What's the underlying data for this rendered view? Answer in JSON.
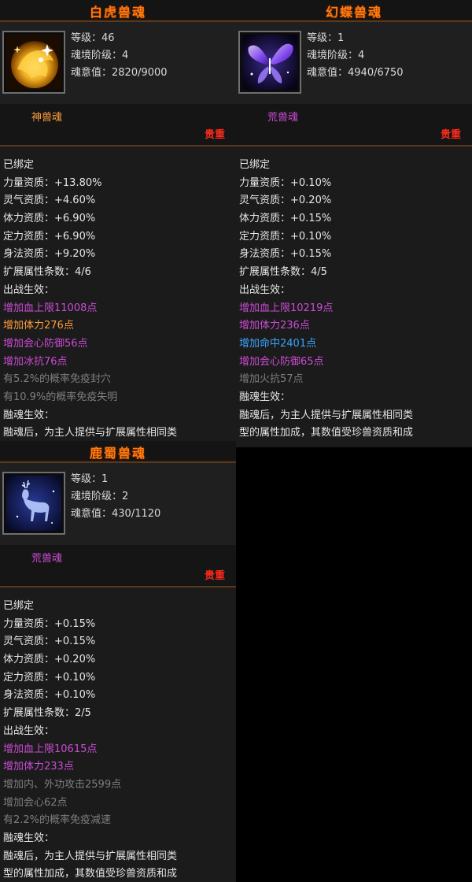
{
  "colors": {
    "title": "#ff7b10",
    "rarity": "#ff2a1a",
    "purple": "#cc4bd6",
    "orange": "#ff9d3a",
    "gray": "#7e7e7e",
    "blue": "#3aa6ff"
  },
  "cards": [
    {
      "title": "白虎兽魂",
      "icon": "golden-tiger-icon",
      "level": "等级：46",
      "realm": "魂境阶级：4",
      "soul_value": "魂意值：2820/9000",
      "soul_type": "神兽魂",
      "rarity": "贵重",
      "lines": [
        {
          "text": "已绑定",
          "color": "w"
        },
        {
          "text": "力量资质：+13.80%",
          "color": "w"
        },
        {
          "text": "灵气资质：+4.60%",
          "color": "w"
        },
        {
          "text": "体力资质：+6.90%",
          "color": "w"
        },
        {
          "text": "定力资质：+6.90%",
          "color": "w"
        },
        {
          "text": "身法资质：+9.20%",
          "color": "w"
        },
        {
          "text": "扩展属性条数：4/6",
          "color": "w"
        },
        {
          "text": "出战生效：",
          "color": "w"
        },
        {
          "text": "增加血上限11008点",
          "color": "pu"
        },
        {
          "text": "增加体力276点",
          "color": "og"
        },
        {
          "text": "增加会心防御56点",
          "color": "pu"
        },
        {
          "text": "增加冰抗76点",
          "color": "pu"
        },
        {
          "text": "有5.2%的概率免疫封穴",
          "color": "gy"
        },
        {
          "text": "有10.9%的概率免疫失明",
          "color": "gy"
        },
        {
          "text": "融魂生效：",
          "color": "w"
        },
        {
          "text": "融魂后，为主人提供与扩展属性相同类",
          "color": "w"
        }
      ]
    },
    {
      "title": "幻蝶兽魂",
      "icon": "butterfly-icon",
      "level": "等级：1",
      "realm": "魂境阶级：4",
      "soul_value": "魂意值：4940/6750",
      "soul_type": "荒兽魂",
      "rarity": "贵重",
      "lines": [
        {
          "text": "已绑定",
          "color": "w"
        },
        {
          "text": "力量资质：+0.10%",
          "color": "w"
        },
        {
          "text": "灵气资质：+0.20%",
          "color": "w"
        },
        {
          "text": "体力资质：+0.15%",
          "color": "w"
        },
        {
          "text": "定力资质：+0.10%",
          "color": "w"
        },
        {
          "text": "身法资质：+0.15%",
          "color": "w"
        },
        {
          "text": "扩展属性条数：4/5",
          "color": "w"
        },
        {
          "text": "出战生效：",
          "color": "w"
        },
        {
          "text": "增加血上限10219点",
          "color": "pu"
        },
        {
          "text": "增加体力236点",
          "color": "pu"
        },
        {
          "text": "增加命中2401点",
          "color": "bl"
        },
        {
          "text": "增加会心防御65点",
          "color": "pu"
        },
        {
          "text": "增加火抗57点",
          "color": "gy"
        },
        {
          "text": "融魂生效：",
          "color": "w"
        },
        {
          "text": "融魂后，为主人提供与扩展属性相同类",
          "color": "w"
        },
        {
          "text": "型的属性加成，其数值受珍兽资质和成",
          "color": "w"
        }
      ]
    },
    {
      "title": "鹿蜀兽魂",
      "icon": "deer-icon",
      "level": "等级：1",
      "realm": "魂境阶级：2",
      "soul_value": "魂意值：430/1120",
      "soul_type": "荒兽魂",
      "rarity": "贵重",
      "lines": [
        {
          "text": "已绑定",
          "color": "w"
        },
        {
          "text": "力量资质：+0.15%",
          "color": "w"
        },
        {
          "text": "灵气资质：+0.15%",
          "color": "w"
        },
        {
          "text": "体力资质：+0.20%",
          "color": "w"
        },
        {
          "text": "定力资质：+0.10%",
          "color": "w"
        },
        {
          "text": "身法资质：+0.10%",
          "color": "w"
        },
        {
          "text": "扩展属性条数：2/5",
          "color": "w"
        },
        {
          "text": "出战生效：",
          "color": "w"
        },
        {
          "text": "增加血上限10615点",
          "color": "pu"
        },
        {
          "text": "增加体力233点",
          "color": "pu"
        },
        {
          "text": "增加内、外功攻击2599点",
          "color": "gy"
        },
        {
          "text": "增加会心62点",
          "color": "gy"
        },
        {
          "text": "有2.2%的概率免疫减速",
          "color": "gy"
        },
        {
          "text": "融魂生效：",
          "color": "w"
        },
        {
          "text": "融魂后，为主人提供与扩展属性相同类",
          "color": "w"
        },
        {
          "text": "型的属性加成，其数值受珍兽资质和成",
          "color": "w"
        }
      ]
    }
  ]
}
